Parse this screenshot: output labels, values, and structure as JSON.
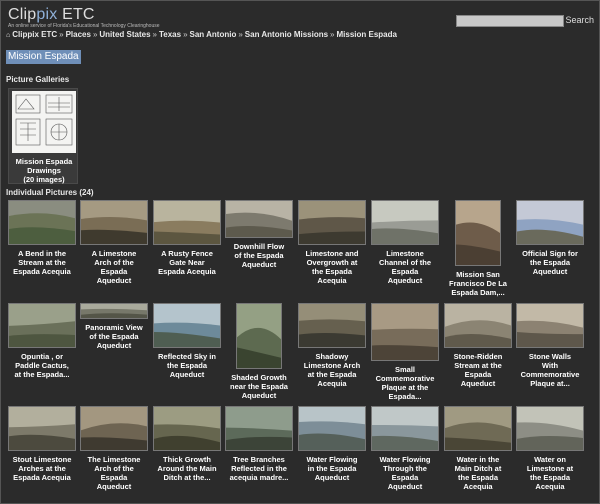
{
  "header": {
    "logo_main_1": "Clip",
    "logo_main_2": "pix",
    "logo_main_3": " ETC",
    "logo_sub": "An online service of Florida's Educational Technology Clearinghouse",
    "search_value": "",
    "search_button": "Search"
  },
  "breadcrumb": {
    "items": [
      "Clippix ETC",
      "Places",
      "United States",
      "Texas",
      "San Antonio",
      "San Antonio Missions",
      "Mission Espada"
    ],
    "separator": "»"
  },
  "page_title": "Mission Espada",
  "galleries": {
    "heading": "Picture Galleries",
    "items": [
      {
        "caption_1": "Mission Espada",
        "caption_2": "Drawings",
        "caption_3": "(20 images)"
      }
    ]
  },
  "pictures": {
    "heading": "Individual Pictures (24)",
    "items": [
      {
        "l1": "A Bend in the",
        "l2": "Stream at the",
        "l3": "Espada Acequia",
        "l4": "",
        "l5": "",
        "palette": [
          "#6b7356",
          "#4d5e3f",
          "#8a8d80"
        ]
      },
      {
        "l1": "A Limestone",
        "l2": "Arch of the",
        "l3": "Espada",
        "l4": "Aqueduct",
        "l5": "",
        "palette": [
          "#7a6d55",
          "#3f3a2e",
          "#a59a82"
        ]
      },
      {
        "l1": "A Rusty Fence",
        "l2": "Gate Near",
        "l3": "Espada Acequia",
        "l4": "",
        "l5": "",
        "palette": [
          "#8a7c5f",
          "#5c5640",
          "#b9b49e"
        ]
      },
      {
        "l1": "Downhill Flow",
        "l2": "of the Espada",
        "l3": "Aqueduct",
        "l4": "",
        "l5": "",
        "palette": [
          "#7d7a6e",
          "#5d5a4d",
          "#b8b3a5"
        ]
      },
      {
        "l1": "Limestone and",
        "l2": "Overgrowth at",
        "l3": "the Espada",
        "l4": "Acequia",
        "l5": "",
        "palette": [
          "#5f5748",
          "#3d3a30",
          "#9b927a"
        ]
      },
      {
        "l1": "Limestone",
        "l2": "Channel of the",
        "l3": "Espada",
        "l4": "Aqueduct",
        "l5": "",
        "palette": [
          "#9a9c95",
          "#6f7268",
          "#c7c9c0"
        ]
      },
      {
        "l1": "Mission San",
        "l2": "Francisco De La",
        "l3": "Espada Dam,...",
        "l4": "",
        "l5": "",
        "palette": [
          "#6e5c4a",
          "#4b3f33",
          "#b7a58c"
        ]
      },
      {
        "l1": "Official Sign for",
        "l2": "the Espada",
        "l3": "Aqueduct",
        "l4": "",
        "l5": "",
        "palette": [
          "#8fa3c2",
          "#6a6a5c",
          "#c4c9d6"
        ]
      },
      {
        "l1": "Opuntia , or",
        "l2": "Paddle Cactus,",
        "l3": "at the Espada...",
        "l4": "",
        "l5": "",
        "palette": [
          "#6a705a",
          "#4e5640",
          "#9aa08a"
        ]
      },
      {
        "l1": "Panoramic View",
        "l2": "of the Espada",
        "l3": "Aqueduct",
        "l4": "",
        "l5": "",
        "palette": [
          "#77786a",
          "#545548",
          "#a9aa9c"
        ]
      },
      {
        "l1": "Reflected Sky in",
        "l2": "the Espada",
        "l3": "Aqueduct",
        "l4": "",
        "l5": "",
        "palette": [
          "#6d8a9a",
          "#4f5e52",
          "#b4c4cc"
        ]
      },
      {
        "l1": "Shaded Growth",
        "l2": "near the Espada",
        "l3": "Aqueduct",
        "l4": "",
        "l5": "",
        "palette": [
          "#5d6a50",
          "#3a4430",
          "#94a084"
        ]
      },
      {
        "l1": "Shadowy",
        "l2": "Limestone Arch",
        "l3": "at the Espada",
        "l4": "Acequia",
        "l5": "",
        "palette": [
          "#66604f",
          "#3b3a32",
          "#958e78"
        ]
      },
      {
        "l1": "Small",
        "l2": "Commemorative",
        "l3": "Plaque at the",
        "l4": "Espada...",
        "l5": "",
        "palette": [
          "#786c5a",
          "#4d4438",
          "#a89a84"
        ]
      },
      {
        "l1": "Stone-Ridden",
        "l2": "Stream at the",
        "l3": "Espada",
        "l4": "Aqueduct",
        "l5": "",
        "palette": [
          "#8b8473",
          "#605a4c",
          "#bab3a2"
        ]
      },
      {
        "l1": "Stone Walls",
        "l2": "With",
        "l3": "Commemorative",
        "l4": "Plaque at...",
        "l5": "",
        "palette": [
          "#8c8272",
          "#5e574b",
          "#c2b9a7"
        ]
      },
      {
        "l1": "Stout Limestone",
        "l2": "Arches at the",
        "l3": "Espada Acequia",
        "l4": "",
        "l5": "",
        "palette": [
          "#7d7a6a",
          "#4c4a3e",
          "#b2af9d"
        ]
      },
      {
        "l1": "The Limestone",
        "l2": "Arch of the",
        "l3": "Espada",
        "l4": "Aqueduct",
        "l5": "",
        "palette": [
          "#6e6452",
          "#3f3a30",
          "#a39780"
        ]
      },
      {
        "l1": "Thick Growth",
        "l2": "Around the Main",
        "l3": "Ditch at the...",
        "l4": "",
        "l5": "",
        "palette": [
          "#66664f",
          "#40402f",
          "#9c9c82"
        ]
      },
      {
        "l1": "Tree Branches",
        "l2": "Reflected in the",
        "l3": "acequia madre...",
        "l4": "",
        "l5": "",
        "palette": [
          "#5c6a5a",
          "#3c4438",
          "#8e9c8c"
        ]
      },
      {
        "l1": "Water Flowing",
        "l2": "in the Espada",
        "l3": "Aqueduct",
        "l4": "",
        "l5": "",
        "palette": [
          "#7d8e98",
          "#55605a",
          "#b8c4c8"
        ]
      },
      {
        "l1": "Water Flowing",
        "l2": "Through the",
        "l3": "Espada",
        "l4": "Aqueduct",
        "l5": "",
        "palette": [
          "#8a979c",
          "#5f6860",
          "#c0c8c8"
        ]
      },
      {
        "l1": "Water in the",
        "l2": "Main Ditch at",
        "l3": "the Espada",
        "l4": "Acequia",
        "l5": "",
        "palette": [
          "#6f6a55",
          "#4a4636",
          "#a09a82"
        ]
      },
      {
        "l1": "Water on",
        "l2": "Limestone at",
        "l3": "the Espada",
        "l4": "Acequia",
        "l5": "",
        "palette": [
          "#8d8e85",
          "#62645a",
          "#c2c3b8"
        ]
      }
    ]
  }
}
